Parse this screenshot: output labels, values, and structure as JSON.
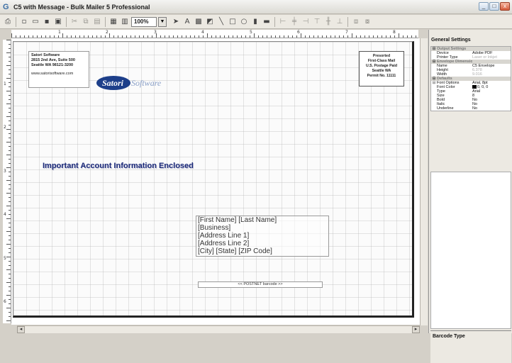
{
  "window": {
    "title": "C5 with Message - Bulk Mailer 5 Professional",
    "app_icon": "app-logo-icon",
    "minimize": "_",
    "maximize": "□",
    "close": "x"
  },
  "toolbar": {
    "zoom": "100%"
  },
  "ruler": {
    "horizontal": [
      "1",
      "2",
      "3",
      "4",
      "5",
      "6",
      "7",
      "8"
    ],
    "vertical": [
      "1",
      "2",
      "3",
      "4",
      "5",
      "6"
    ]
  },
  "envelope": {
    "return_address": [
      "Satori Software",
      "2815 2nd Ave, Suite 500",
      "Seattle WA 98121-3200"
    ],
    "return_url": "www.satorisoftware.com",
    "logo_main": "Satori",
    "logo_rest": "Software",
    "permit": [
      "Presorted",
      "First-Class Mail",
      "U.S. Postage Paid",
      "Seattle WA",
      "Permit No. 11111"
    ],
    "headline": "Important Account Information Enclosed",
    "address": [
      "[First Name] [Last Name]",
      "[Business]",
      "[Address Line 1]",
      "[Address Line 2]",
      "[City] [State] [ZIP Code]"
    ],
    "barcode": "<< POSTNET barcode >>"
  },
  "panel": {
    "title": "General Settings",
    "properties": [
      {
        "type": "cat",
        "expand": "⊟",
        "key": "Output Settings",
        "value": ""
      },
      {
        "type": "row",
        "key": "Device",
        "value": "Adobe PDF"
      },
      {
        "type": "row",
        "key": "Printer Type",
        "value": "Laser or Inkjet",
        "grey": true
      },
      {
        "type": "cat",
        "expand": "⊟",
        "key": "Envelope Dimensions",
        "value": ""
      },
      {
        "type": "row",
        "key": "Name",
        "value": "C5 Envelope"
      },
      {
        "type": "row",
        "key": "Height",
        "value": "6.378",
        "grey": true
      },
      {
        "type": "row",
        "key": "Width",
        "value": "9.016",
        "grey": true
      },
      {
        "type": "cat",
        "expand": "⊟",
        "key": "Defaults",
        "value": ""
      },
      {
        "type": "row",
        "expand": "⊟",
        "key": "Font Options",
        "value": "Arial, 8pt"
      },
      {
        "type": "row",
        "key": "Font Color",
        "value": "0, 0, 0",
        "swatch": true
      },
      {
        "type": "row",
        "key": "Type",
        "value": "Arial"
      },
      {
        "type": "row",
        "key": "Size",
        "value": "8"
      },
      {
        "type": "row",
        "key": "Bold",
        "value": "No"
      },
      {
        "type": "row",
        "key": "Italic",
        "value": "No"
      },
      {
        "type": "row",
        "key": "Underline",
        "value": "No"
      }
    ],
    "bottom_title": "Barcode Type"
  }
}
